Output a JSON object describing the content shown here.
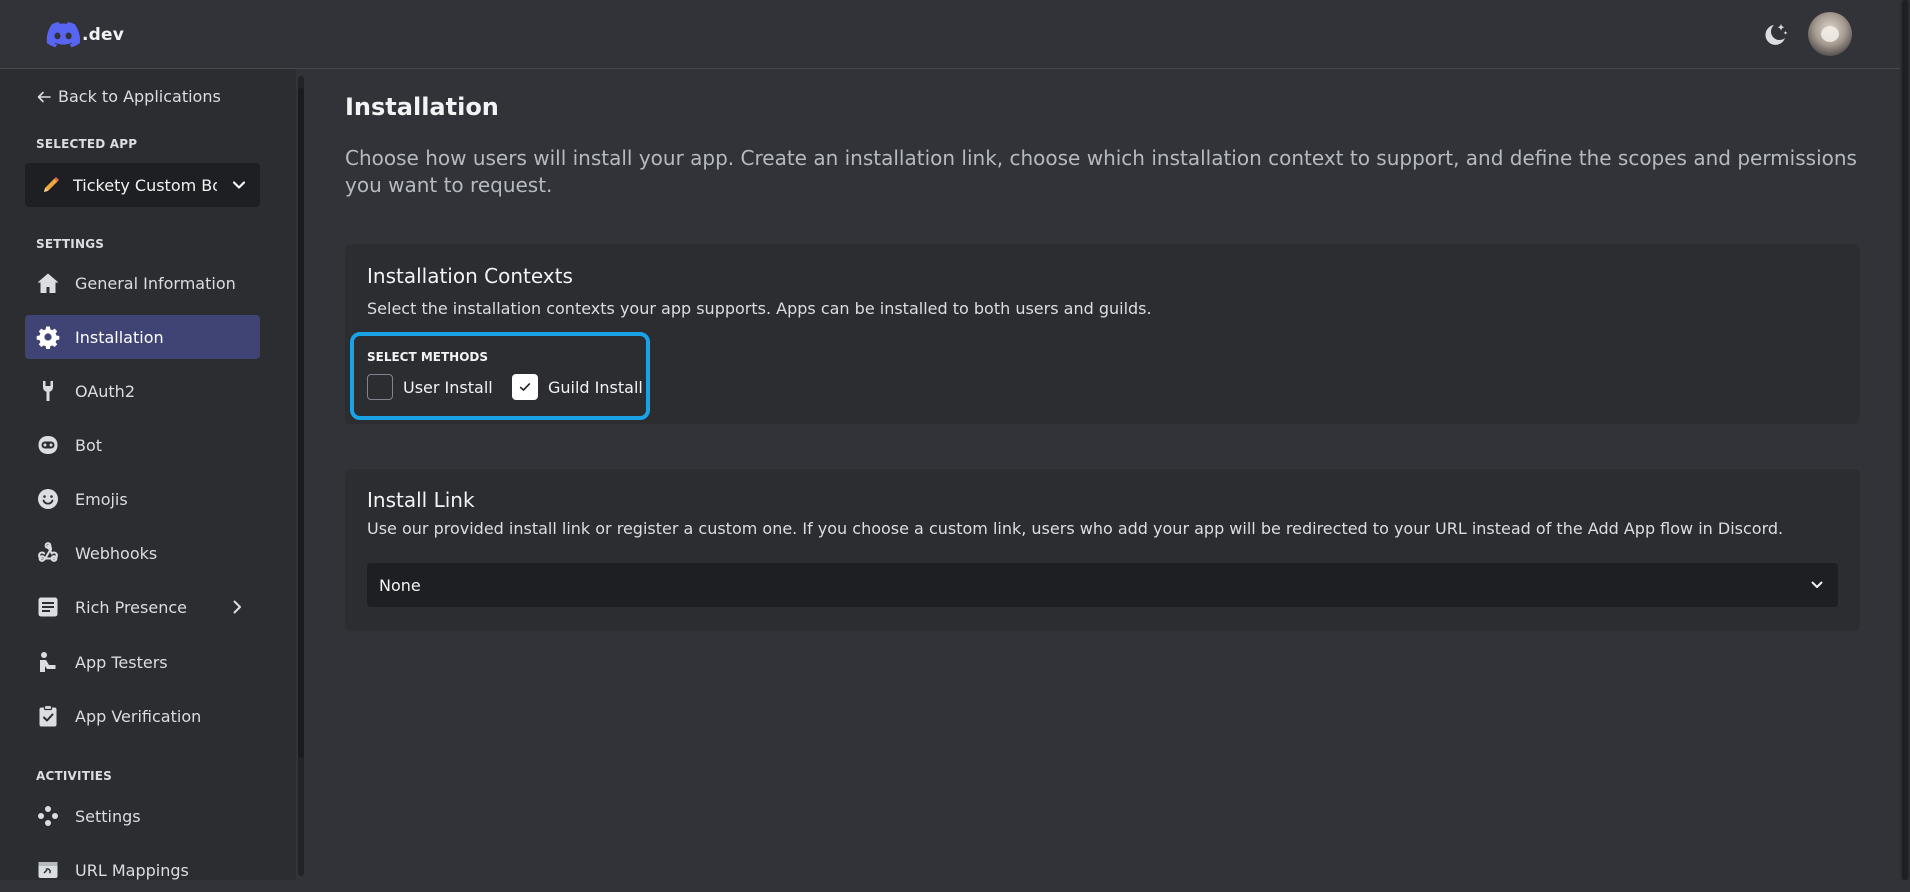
{
  "brand": {
    "logo_text": ".dev"
  },
  "header": {
    "theme_toggle_icon": "moon-stars-icon"
  },
  "sidebar": {
    "back_label": "Back to Applications",
    "selected_app_heading": "SELECTED APP",
    "selected_app_name": "Tickety Custom Bo",
    "settings_heading": "SETTINGS",
    "items": [
      {
        "label": "General Information",
        "icon": "home-icon"
      },
      {
        "label": "Installation",
        "icon": "gear-icon",
        "active": true
      },
      {
        "label": "OAuth2",
        "icon": "wrench-icon"
      },
      {
        "label": "Bot",
        "icon": "bot-icon"
      },
      {
        "label": "Emojis",
        "icon": "smile-icon"
      },
      {
        "label": "Webhooks",
        "icon": "webhook-icon"
      },
      {
        "label": "Rich Presence",
        "icon": "rich-presence-icon"
      },
      {
        "label": "App Testers",
        "icon": "app-testers-icon"
      },
      {
        "label": "App Verification",
        "icon": "verification-icon"
      }
    ],
    "activities_heading": "ACTIVITIES",
    "activities_items": [
      {
        "label": "Settings",
        "icon": "activities-settings-icon"
      },
      {
        "label": "URL Mappings",
        "icon": "url-mappings-icon"
      }
    ]
  },
  "main": {
    "title": "Installation",
    "description": "Choose how users will install your app. Create an installation link, choose which installation context to support, and define the scopes and permissions you want to request.",
    "contexts": {
      "title": "Installation Contexts",
      "description": "Select the installation contexts your app supports. Apps can be installed to both users and guilds.",
      "methods_label": "SELECT METHODS",
      "options": [
        {
          "label": "User Install",
          "checked": false
        },
        {
          "label": "Guild Install",
          "checked": true
        }
      ]
    },
    "install_link": {
      "title": "Install Link",
      "description": "Use our provided install link or register a custom one. If you choose a custom link, users who add your app will be redirected to your URL instead of the Add App flow in Discord.",
      "selected_value": "None"
    }
  },
  "colors": {
    "background": "#313338",
    "sidebar": "#2b2d31",
    "active_item": "#404475",
    "highlight_border": "#1aa2e6",
    "input_bg": "#1e1f22"
  }
}
